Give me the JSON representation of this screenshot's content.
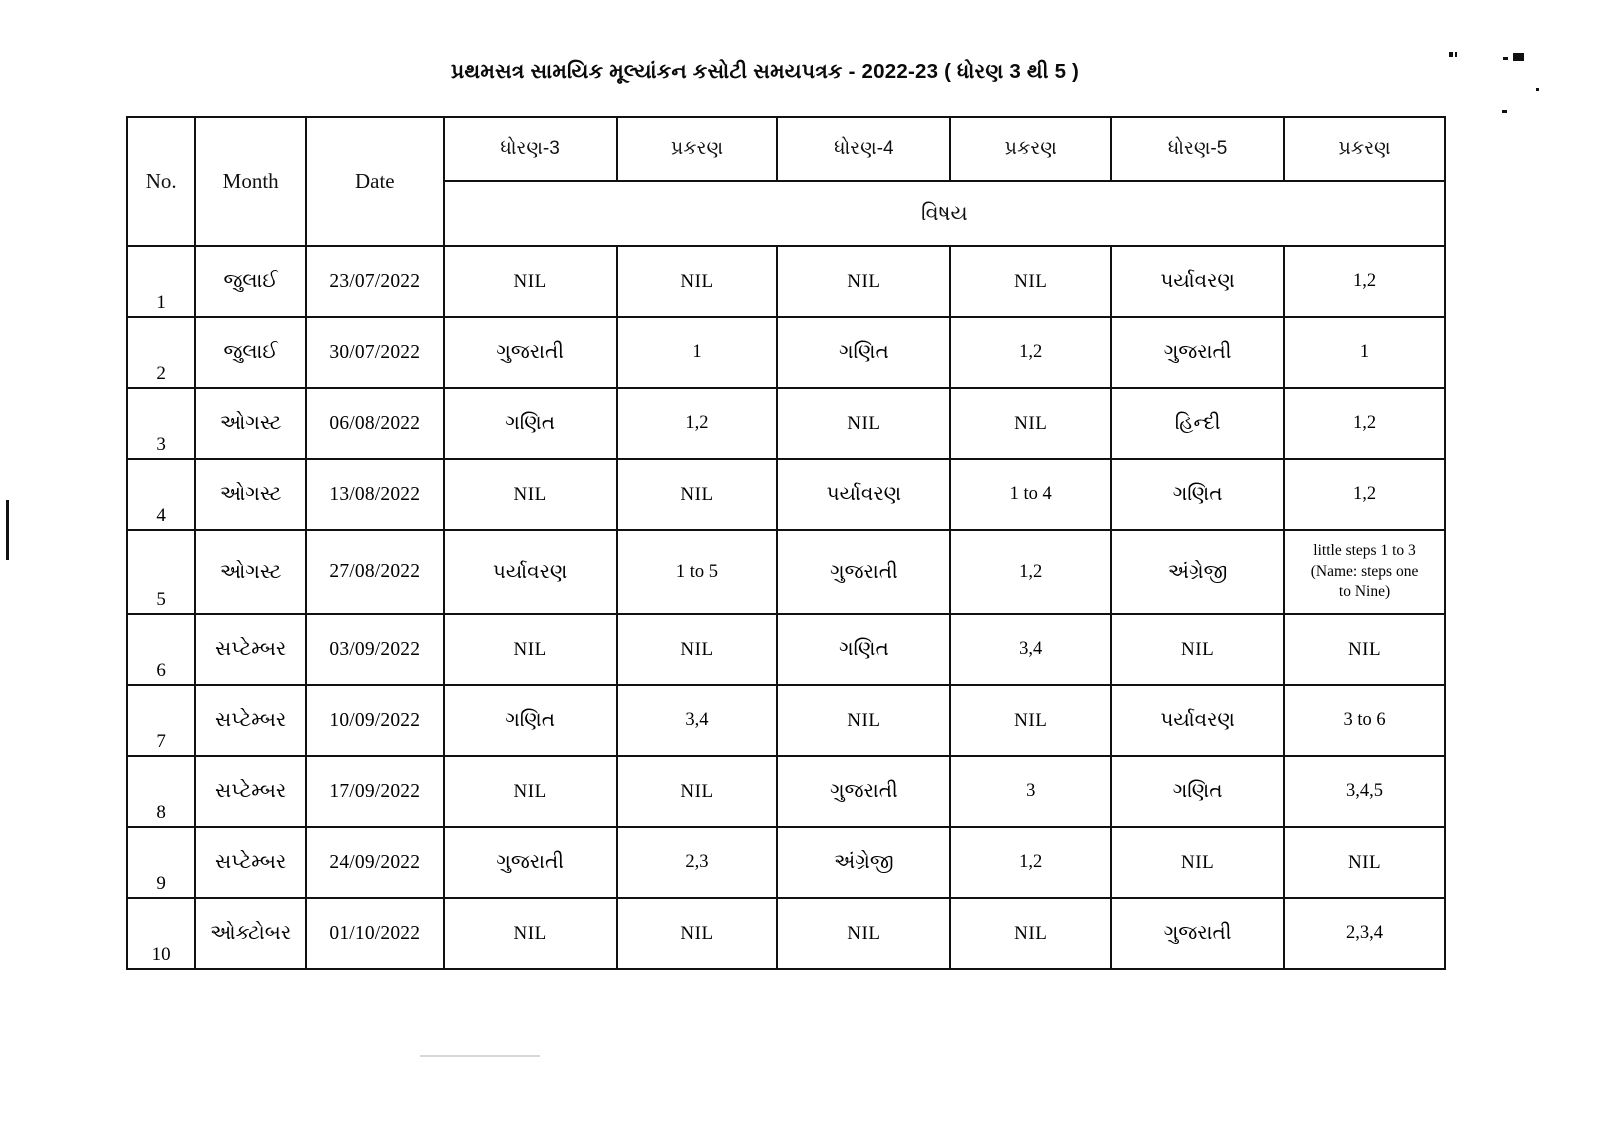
{
  "document": {
    "title": "પ્રથમસત્ર સામયિક મૂલ્યાંકન કસોટી  સમયપત્રક - 2022-23 ( ધોરણ 3 થી 5 )"
  },
  "table": {
    "headers": {
      "no": "No.",
      "month": "Month",
      "date": "Date",
      "grade3": "ધોરણ-3",
      "chapter3": "પ્રકરણ",
      "grade4": "ધોરણ-4",
      "chapter4": "પ્રકરણ",
      "grade5": "ધોરણ-5",
      "chapter5": "પ્રકરણ",
      "subject_span": "વિષય"
    },
    "nil_label": "NIL",
    "rows": [
      {
        "no": "1",
        "month": "જુલાઈ",
        "date": "23/07/2022",
        "g3_subject": "NIL",
        "g3_subject_nil": true,
        "g3_chapter": "NIL",
        "g3_chapter_nil": true,
        "g4_subject": "NIL",
        "g4_subject_nil": true,
        "g4_chapter": "NIL",
        "g4_chapter_nil": true,
        "g5_subject": "પર્યાવરણ",
        "g5_subject_nil": false,
        "g5_chapter": "1,2",
        "g5_chapter_nil": false
      },
      {
        "no": "2",
        "month": "જુલાઈ",
        "date": "30/07/2022",
        "g3_subject": "ગુજરાતી",
        "g3_subject_nil": false,
        "g3_chapter": "1",
        "g3_chapter_nil": false,
        "g4_subject": "ગણિત",
        "g4_subject_nil": false,
        "g4_chapter": "1,2",
        "g4_chapter_nil": false,
        "g5_subject": "ગુજરાતી",
        "g5_subject_nil": false,
        "g5_chapter": "1",
        "g5_chapter_nil": false
      },
      {
        "no": "3",
        "month": "ઓગસ્ટ",
        "date": "06/08/2022",
        "g3_subject": "ગણિત",
        "g3_subject_nil": false,
        "g3_chapter": "1,2",
        "g3_chapter_nil": false,
        "g4_subject": "NIL",
        "g4_subject_nil": true,
        "g4_chapter": "NIL",
        "g4_chapter_nil": true,
        "g5_subject": "હિન્દી",
        "g5_subject_nil": false,
        "g5_chapter": "1,2",
        "g5_chapter_nil": false
      },
      {
        "no": "4",
        "month": "ઓગસ્ટ",
        "date": "13/08/2022",
        "g3_subject": "NIL",
        "g3_subject_nil": true,
        "g3_chapter": "NIL",
        "g3_chapter_nil": true,
        "g4_subject": "પર્યાવરણ",
        "g4_subject_nil": false,
        "g4_chapter": "1 to 4",
        "g4_chapter_nil": false,
        "g5_subject": "ગણિત",
        "g5_subject_nil": false,
        "g5_chapter": "1,2",
        "g5_chapter_nil": false
      },
      {
        "no": "5",
        "month": "ઓગસ્ટ",
        "date": "27/08/2022",
        "g3_subject": "પર્યાવરણ",
        "g3_subject_nil": false,
        "g3_chapter": "1  to 5",
        "g3_chapter_nil": false,
        "g4_subject": "ગુજરાતી",
        "g4_subject_nil": false,
        "g4_chapter": "1,2",
        "g4_chapter_nil": false,
        "g5_subject": "અંગ્રેજી",
        "g5_subject_nil": false,
        "g5_chapter": "little steps 1 to 3\n(Name:  steps one\nto Nine)",
        "g5_chapter_nil": false,
        "g5_chapter_multiline": true
      },
      {
        "no": "6",
        "month": "સપ્ટેમ્બર",
        "date": "03/09/2022",
        "g3_subject": "NIL",
        "g3_subject_nil": true,
        "g3_chapter": "NIL",
        "g3_chapter_nil": true,
        "g4_subject": "ગણિત",
        "g4_subject_nil": false,
        "g4_chapter": "3,4",
        "g4_chapter_nil": false,
        "g5_subject": "NIL",
        "g5_subject_nil": true,
        "g5_chapter": "NIL",
        "g5_chapter_nil": true
      },
      {
        "no": "7",
        "month": "સપ્ટેમ્બર",
        "date": "10/09/2022",
        "g3_subject": "ગણિત",
        "g3_subject_nil": false,
        "g3_chapter": "3,4",
        "g3_chapter_nil": false,
        "g4_subject": "NIL",
        "g4_subject_nil": true,
        "g4_chapter": "NIL",
        "g4_chapter_nil": true,
        "g5_subject": "પર્યાવરણ",
        "g5_subject_nil": false,
        "g5_chapter": "3 to 6",
        "g5_chapter_nil": false
      },
      {
        "no": "8",
        "month": "સપ્ટેમ્બર",
        "date": "17/09/2022",
        "g3_subject": "NIL",
        "g3_subject_nil": true,
        "g3_chapter": "NIL",
        "g3_chapter_nil": true,
        "g4_subject": "ગુજરાતી",
        "g4_subject_nil": false,
        "g4_chapter": "3",
        "g4_chapter_nil": false,
        "g5_subject": "ગણિત",
        "g5_subject_nil": false,
        "g5_chapter": "3,4,5",
        "g5_chapter_nil": false
      },
      {
        "no": "9",
        "month": "સપ્ટેમ્બર",
        "date": "24/09/2022",
        "g3_subject": "ગુજરાતી",
        "g3_subject_nil": false,
        "g3_chapter": "2,3",
        "g3_chapter_nil": false,
        "g4_subject": "અંગ્રેજી",
        "g4_subject_nil": false,
        "g4_chapter": "1,2",
        "g4_chapter_nil": false,
        "g5_subject": "NIL",
        "g5_subject_nil": true,
        "g5_chapter": "NIL",
        "g5_chapter_nil": true
      },
      {
        "no": "10",
        "month": "ઓક્ટોબર",
        "date": "01/10/2022",
        "g3_subject": "NIL",
        "g3_subject_nil": true,
        "g3_chapter": "NIL",
        "g3_chapter_nil": true,
        "g4_subject": "NIL",
        "g4_subject_nil": true,
        "g4_chapter": "NIL",
        "g4_chapter_nil": true,
        "g5_subject": "ગુજરાતી",
        "g5_subject_nil": false,
        "g5_chapter": "2,3,4",
        "g5_chapter_nil": false
      }
    ]
  }
}
